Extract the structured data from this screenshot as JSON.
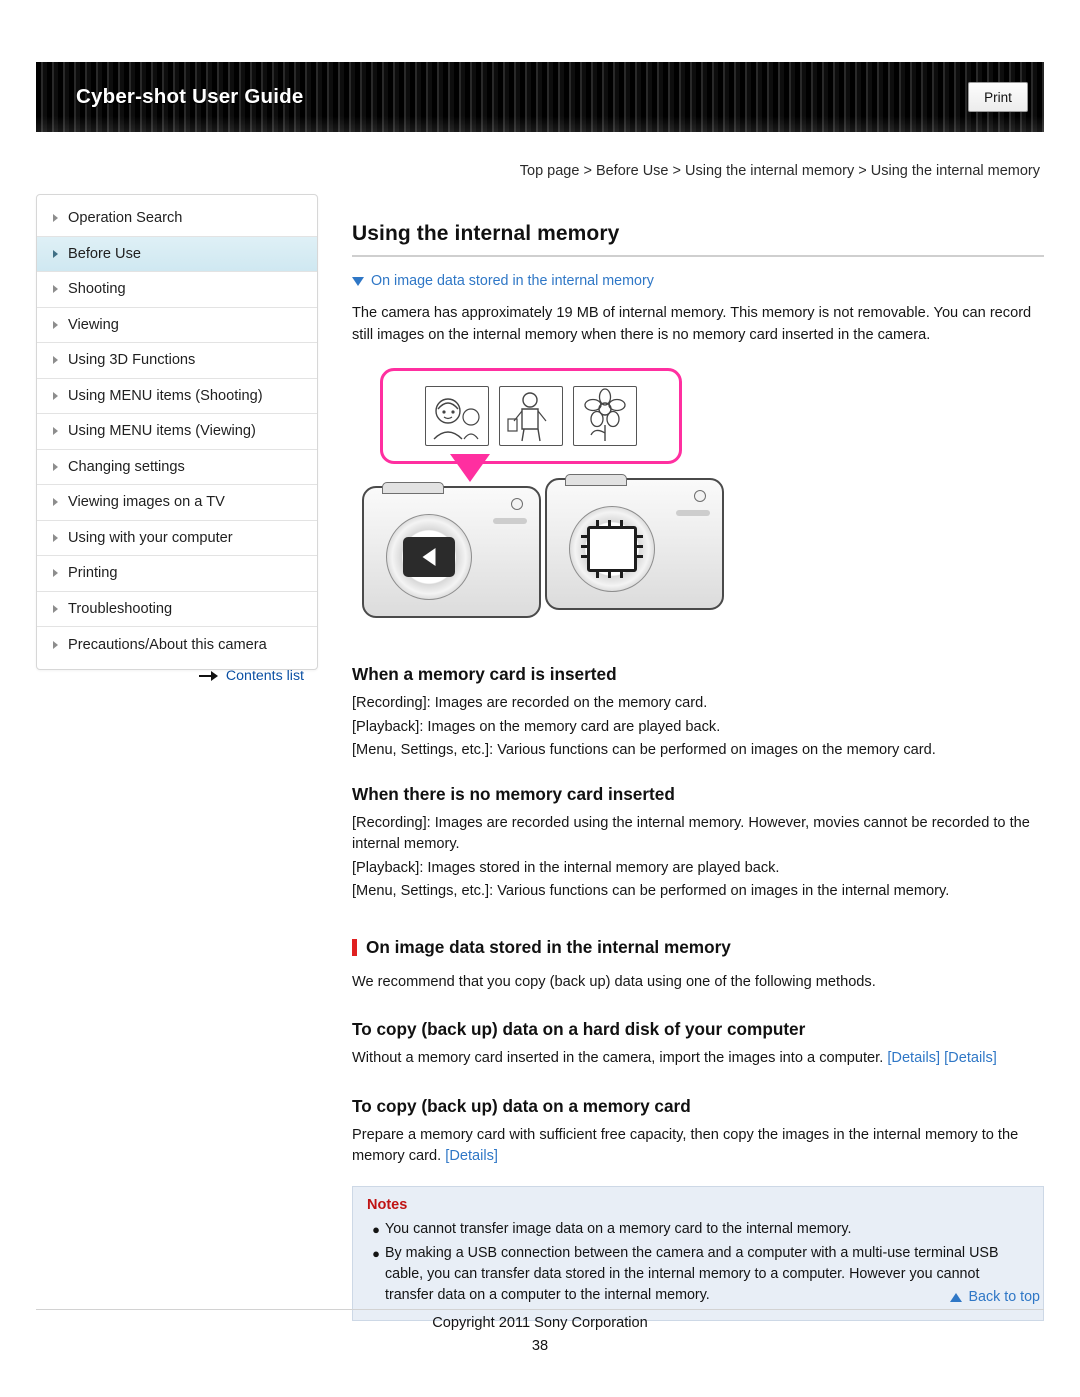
{
  "header": {
    "title": "Cyber-shot User Guide",
    "print_label": "Print"
  },
  "breadcrumb": {
    "text": "Top page > Before Use > Using the internal memory > Using the internal memory"
  },
  "sidebar": {
    "items": [
      {
        "label": "Operation Search",
        "selected": false
      },
      {
        "label": "Before Use",
        "selected": true
      },
      {
        "label": "Shooting",
        "selected": false
      },
      {
        "label": "Viewing",
        "selected": false
      },
      {
        "label": "Using 3D Functions",
        "selected": false
      },
      {
        "label": "Using MENU items (Shooting)",
        "selected": false
      },
      {
        "label": "Using MENU items (Viewing)",
        "selected": false
      },
      {
        "label": "Changing settings",
        "selected": false
      },
      {
        "label": "Viewing images on a TV",
        "selected": false
      },
      {
        "label": "Using with your computer",
        "selected": false
      },
      {
        "label": "Printing",
        "selected": false
      },
      {
        "label": "Troubleshooting",
        "selected": false
      },
      {
        "label": "Precautions/About this camera",
        "selected": false
      }
    ],
    "contents_list_label": "Contents list"
  },
  "main": {
    "page_title": "Using the internal memory",
    "jump_link": "On image data stored in the internal memory",
    "intro": "The camera has approximately 19 MB of internal memory. This memory is not removable. You can record still images on the internal memory when there is no memory card inserted in the camera.",
    "section_card_inserted": {
      "heading": "When a memory card is inserted",
      "lines": [
        "[Recording]: Images are recorded on the memory card.",
        "[Playback]: Images on the memory card are played back.",
        "[Menu, Settings, etc.]: Various functions can be performed on images on the memory card."
      ]
    },
    "section_no_card": {
      "heading": "When there is no memory card inserted",
      "lines": [
        "[Recording]: Images are recorded using the internal memory. However, movies cannot be recorded to the internal memory.",
        "[Playback]: Images stored in the internal memory are played back.",
        "[Menu, Settings, etc.]: Various functions can be performed on images in the internal memory."
      ]
    },
    "section_on_image_data": {
      "heading": "On image data stored in the internal memory",
      "text": "We recommend that you copy (back up) data using one of the following methods."
    },
    "section_hard_disk": {
      "heading": "To copy (back up) data on a hard disk of your computer",
      "text_before": "Without a memory card inserted in the camera, import the images into a computer. ",
      "link1": "[Details]",
      "link2": "[Details]"
    },
    "section_memory_card": {
      "heading": "To copy (back up) data on a memory card",
      "text_before": "Prepare a memory card with sufficient free capacity, then copy the images in the internal memory to the memory card. ",
      "link": "[Details]"
    },
    "notes": {
      "title": "Notes",
      "items": [
        "You cannot transfer image data on a memory card to the internal memory.",
        "By making a USB connection between the camera and a computer with a multi-use terminal USB cable, you can transfer data stored in the internal memory to a computer. However you cannot transfer data on a computer to the internal memory."
      ]
    },
    "figure": {
      "thumbnail_labels": [
        "portrait-photo-thumbnail",
        "person-photo-thumbnail",
        "flower-photo-thumbnail"
      ],
      "camera_left_label": "camera-with-memory-card",
      "camera_right_label": "camera-with-internal-memory"
    }
  },
  "footer": {
    "back_to_top": "Back to top",
    "copyright": "Copyright 2011 Sony Corporation",
    "page_number": "38"
  },
  "colors": {
    "accent_link": "#2f77c6",
    "notes_bg": "#e8eef6",
    "red_bar": "#e02020",
    "figure_highlight": "#ff2fa0",
    "sidebar_selected": "#cfe8f1"
  }
}
